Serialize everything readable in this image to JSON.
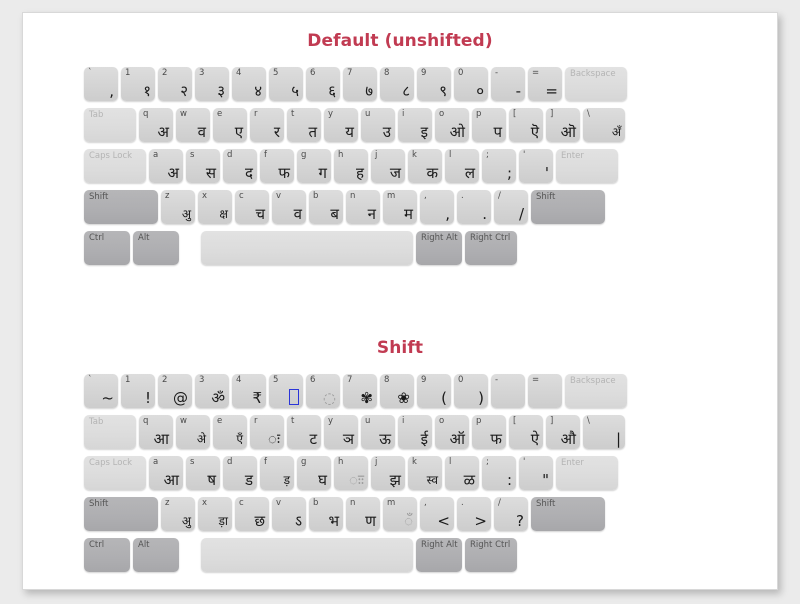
{
  "page": {
    "background": "#ffffff",
    "accent": "#c13b52"
  },
  "sections": [
    {
      "id": "default",
      "title": "Default (unshifted)",
      "rows": [
        {
          "id": "number-row",
          "keys": [
            {
              "legend": "`",
              "main": ","
            },
            {
              "legend": "1",
              "main": "१"
            },
            {
              "legend": "2",
              "main": "२"
            },
            {
              "legend": "3",
              "main": "३"
            },
            {
              "legend": "4",
              "main": "४"
            },
            {
              "legend": "5",
              "main": "५"
            },
            {
              "legend": "6",
              "main": "६"
            },
            {
              "legend": "7",
              "main": "७"
            },
            {
              "legend": "8",
              "main": "८"
            },
            {
              "legend": "9",
              "main": "९"
            },
            {
              "legend": "0",
              "main": "०"
            },
            {
              "legend": "-",
              "main": "-"
            },
            {
              "legend": "=",
              "main": "="
            },
            {
              "name": "Backspace",
              "style": "blank",
              "width": "w-back"
            }
          ]
        },
        {
          "id": "top-row",
          "keys": [
            {
              "name": "Tab",
              "style": "blank",
              "width": "w-tab"
            },
            {
              "legend": "q",
              "main": "अ"
            },
            {
              "legend": "w",
              "main": "व"
            },
            {
              "legend": "e",
              "main": "ए"
            },
            {
              "legend": "r",
              "main": "र"
            },
            {
              "legend": "t",
              "main": "त"
            },
            {
              "legend": "y",
              "main": "य"
            },
            {
              "legend": "u",
              "main": "उ"
            },
            {
              "legend": "i",
              "main": "इ"
            },
            {
              "legend": "o",
              "main": "ओ"
            },
            {
              "legend": "p",
              "main": "प"
            },
            {
              "legend": "[",
              "main": "ऎ"
            },
            {
              "legend": "]",
              "main": "ऒ"
            },
            {
              "legend": "\\",
              "main": "अँ",
              "width": "w-bsl"
            }
          ]
        },
        {
          "id": "home-row",
          "keys": [
            {
              "name": "Caps Lock",
              "style": "blank",
              "width": "w-caps"
            },
            {
              "legend": "a",
              "main": "अ"
            },
            {
              "legend": "s",
              "main": "स"
            },
            {
              "legend": "d",
              "main": "द"
            },
            {
              "legend": "f",
              "main": "फ"
            },
            {
              "legend": "g",
              "main": "ग"
            },
            {
              "legend": "h",
              "main": "ह"
            },
            {
              "legend": "j",
              "main": "ज"
            },
            {
              "legend": "k",
              "main": "क"
            },
            {
              "legend": "l",
              "main": "ल"
            },
            {
              "legend": ";",
              "main": ";"
            },
            {
              "legend": "'",
              "main": "'"
            },
            {
              "name": "Enter",
              "style": "blank",
              "width": "w-enter"
            }
          ]
        },
        {
          "id": "bottom-row",
          "keys": [
            {
              "name": "Shift",
              "style": "mod",
              "width": "w-shift"
            },
            {
              "legend": "z",
              "main": "अु"
            },
            {
              "legend": "x",
              "main": "क्ष"
            },
            {
              "legend": "c",
              "main": "च"
            },
            {
              "legend": "v",
              "main": "व"
            },
            {
              "legend": "b",
              "main": "ब"
            },
            {
              "legend": "n",
              "main": "न"
            },
            {
              "legend": "m",
              "main": "म"
            },
            {
              "legend": ",",
              "main": ","
            },
            {
              "legend": ".",
              "main": "."
            },
            {
              "legend": "/",
              "main": "/"
            },
            {
              "name": "Shift",
              "style": "mod",
              "width": "w-shift"
            }
          ]
        },
        {
          "id": "modifier-row",
          "keys": [
            {
              "name": "Ctrl",
              "style": "mod",
              "width": "w-ctrl"
            },
            {
              "name": "Alt",
              "style": "mod",
              "width": "w-alt",
              "gap": "gap-sm"
            },
            {
              "name": "",
              "style": "blank",
              "width": "w-space"
            },
            {
              "name": "Right Alt",
              "style": "mod",
              "width": "w-ralt"
            },
            {
              "name": "Right Ctrl",
              "style": "mod",
              "width": "w-rctrl",
              "gap": "gap-md"
            }
          ]
        }
      ]
    },
    {
      "id": "shift",
      "title": "Shift",
      "rows": [
        {
          "id": "number-row",
          "keys": [
            {
              "legend": "`",
              "main": "~"
            },
            {
              "legend": "1",
              "main": "!"
            },
            {
              "legend": "2",
              "main": "@"
            },
            {
              "legend": "3",
              "main": "ॐ"
            },
            {
              "legend": "4",
              "main": "₹"
            },
            {
              "legend": "5",
              "main": "",
              "glyph": "tofu"
            },
            {
              "legend": "6",
              "main": "◌",
              "glyph": "dotted"
            },
            {
              "legend": "7",
              "main": "✾"
            },
            {
              "legend": "8",
              "main": "❀"
            },
            {
              "legend": "9",
              "main": "("
            },
            {
              "legend": "0",
              "main": ")"
            },
            {
              "legend": "-",
              "main": ""
            },
            {
              "legend": "=",
              "main": ""
            },
            {
              "name": "Backspace",
              "style": "blank",
              "width": "w-back"
            }
          ]
        },
        {
          "id": "top-row",
          "keys": [
            {
              "name": "Tab",
              "style": "blank",
              "width": "w-tab"
            },
            {
              "legend": "q",
              "main": "आ"
            },
            {
              "legend": "w",
              "main": "अे"
            },
            {
              "legend": "e",
              "main": "एँ"
            },
            {
              "legend": "r",
              "main": "ः"
            },
            {
              "legend": "t",
              "main": "ट"
            },
            {
              "legend": "y",
              "main": "ञ"
            },
            {
              "legend": "u",
              "main": "ऊ"
            },
            {
              "legend": "i",
              "main": "ई"
            },
            {
              "legend": "o",
              "main": "ऑ"
            },
            {
              "legend": "p",
              "main": "फ"
            },
            {
              "legend": "[",
              "main": "ऐ"
            },
            {
              "legend": "]",
              "main": "औ"
            },
            {
              "legend": "\\",
              "main": "|",
              "width": "w-bsl"
            }
          ]
        },
        {
          "id": "home-row",
          "keys": [
            {
              "name": "Caps Lock",
              "style": "blank",
              "width": "w-caps"
            },
            {
              "legend": "a",
              "main": "आ"
            },
            {
              "legend": "s",
              "main": "ष"
            },
            {
              "legend": "d",
              "main": "ड"
            },
            {
              "legend": "f",
              "main": "ड़"
            },
            {
              "legend": "g",
              "main": "घ"
            },
            {
              "legend": "h",
              "main": "ःः",
              "glyph": "dotted-visarga"
            },
            {
              "legend": "j",
              "main": "झ"
            },
            {
              "legend": "k",
              "main": "स्व"
            },
            {
              "legend": "l",
              "main": "ळ"
            },
            {
              "legend": ";",
              "main": ":"
            },
            {
              "legend": "'",
              "main": "\""
            },
            {
              "name": "Enter",
              "style": "blank",
              "width": "w-enter"
            }
          ]
        },
        {
          "id": "bottom-row",
          "keys": [
            {
              "name": "Shift",
              "style": "mod",
              "width": "w-shift"
            },
            {
              "legend": "z",
              "main": "अु"
            },
            {
              "legend": "x",
              "main": "ड़ा"
            },
            {
              "legend": "c",
              "main": "छ"
            },
            {
              "legend": "v",
              "main": "ऽ"
            },
            {
              "legend": "b",
              "main": "भ"
            },
            {
              "legend": "n",
              "main": "ण"
            },
            {
              "legend": "m",
              "main": "◌ँ",
              "glyph": "dotted-anusvara"
            },
            {
              "legend": ",",
              "main": "<"
            },
            {
              "legend": ".",
              "main": ">"
            },
            {
              "legend": "/",
              "main": "?"
            },
            {
              "name": "Shift",
              "style": "mod",
              "width": "w-shift"
            }
          ]
        },
        {
          "id": "modifier-row",
          "keys": [
            {
              "name": "Ctrl",
              "style": "mod",
              "width": "w-ctrl"
            },
            {
              "name": "Alt",
              "style": "mod",
              "width": "w-alt",
              "gap": "gap-sm"
            },
            {
              "name": "",
              "style": "blank",
              "width": "w-space"
            },
            {
              "name": "Right Alt",
              "style": "mod",
              "width": "w-ralt"
            },
            {
              "name": "Right Ctrl",
              "style": "mod",
              "width": "w-rctrl",
              "gap": "gap-md"
            }
          ]
        }
      ]
    }
  ]
}
